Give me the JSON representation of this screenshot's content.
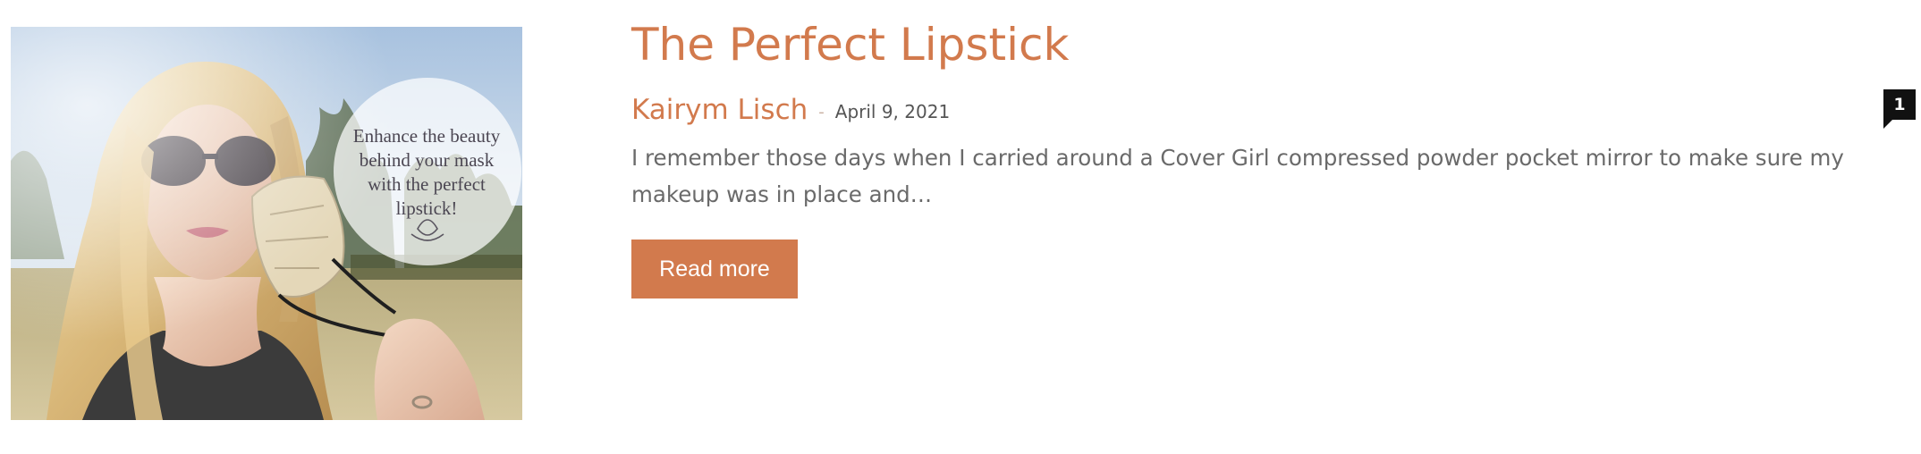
{
  "post": {
    "title": "The Perfect Lipstick",
    "author": "Kairym Lisch",
    "separator": "-",
    "date": "April 9, 2021",
    "excerpt": "I remember those days when I carried around a Cover Girl compressed powder pocket mirror to make sure my makeup was in place and…",
    "read_more_label": "Read more",
    "comment_count": "1",
    "image_caption": "Enhance the beauty behind your mask with the perfect lipstick!"
  },
  "colors": {
    "accent": "#d27a4d",
    "text_muted": "#6a6a6a",
    "badge_bg": "#111111"
  },
  "icons": {
    "comment_badge": "speech-bubble-icon"
  }
}
